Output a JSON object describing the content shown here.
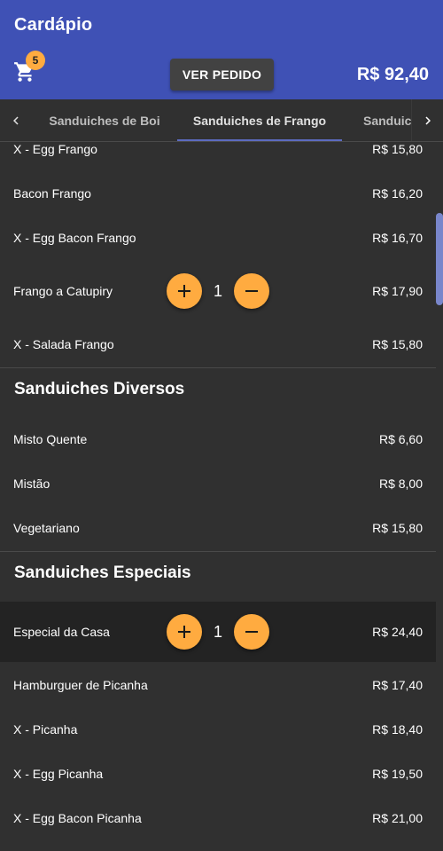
{
  "app": {
    "title": "Cardápio"
  },
  "header": {
    "cart_count": "5",
    "ver_pedido_label": "VER PEDIDO",
    "total": "R$ 92,40"
  },
  "tabs": [
    {
      "label": "Sanduiches de Boi",
      "active": false
    },
    {
      "label": "Sanduiches de Frango",
      "active": true
    },
    {
      "label": "Sanduiches Diversos",
      "active": false
    }
  ],
  "sections": [
    {
      "title": "",
      "items": [
        {
          "name": "X - Egg Frango",
          "price": "R$ 15,80"
        },
        {
          "name": "Bacon Frango",
          "price": "R$ 16,20"
        },
        {
          "name": "X - Egg Bacon Frango",
          "price": "R$ 16,70"
        },
        {
          "name": "Frango a Catupiry",
          "price": "R$ 17,90",
          "quantity": "1"
        },
        {
          "name": "X - Salada Frango",
          "price": "R$ 15,80"
        }
      ]
    },
    {
      "title": "Sanduiches Diversos",
      "items": [
        {
          "name": "Misto Quente",
          "price": "R$ 6,60"
        },
        {
          "name": "Mistão",
          "price": "R$ 8,00"
        },
        {
          "name": "Vegetariano",
          "price": "R$ 15,80"
        }
      ]
    },
    {
      "title": "Sanduiches Especiais",
      "items": [
        {
          "name": "Especial da Casa",
          "price": "R$ 24,40",
          "quantity": "1",
          "selected": true
        },
        {
          "name": "Hamburguer de Picanha",
          "price": "R$ 17,40"
        },
        {
          "name": "X - Picanha",
          "price": "R$ 18,40"
        },
        {
          "name": "X - Egg Picanha",
          "price": "R$ 19,50"
        },
        {
          "name": "X - Egg Bacon Picanha",
          "price": "R$ 21,00"
        }
      ]
    }
  ],
  "colors": {
    "app_bar": "#3f51b5",
    "background": "#303030",
    "accent": "#ffab40",
    "tab_indicator": "#5c6bc0",
    "scroll_thumb": "#7986cb"
  },
  "icons": {
    "cart": "shopping-cart-icon",
    "tab_left": "chevron-left-icon",
    "tab_right": "chevron-right-icon",
    "add": "plus-icon",
    "remove": "minus-icon"
  }
}
